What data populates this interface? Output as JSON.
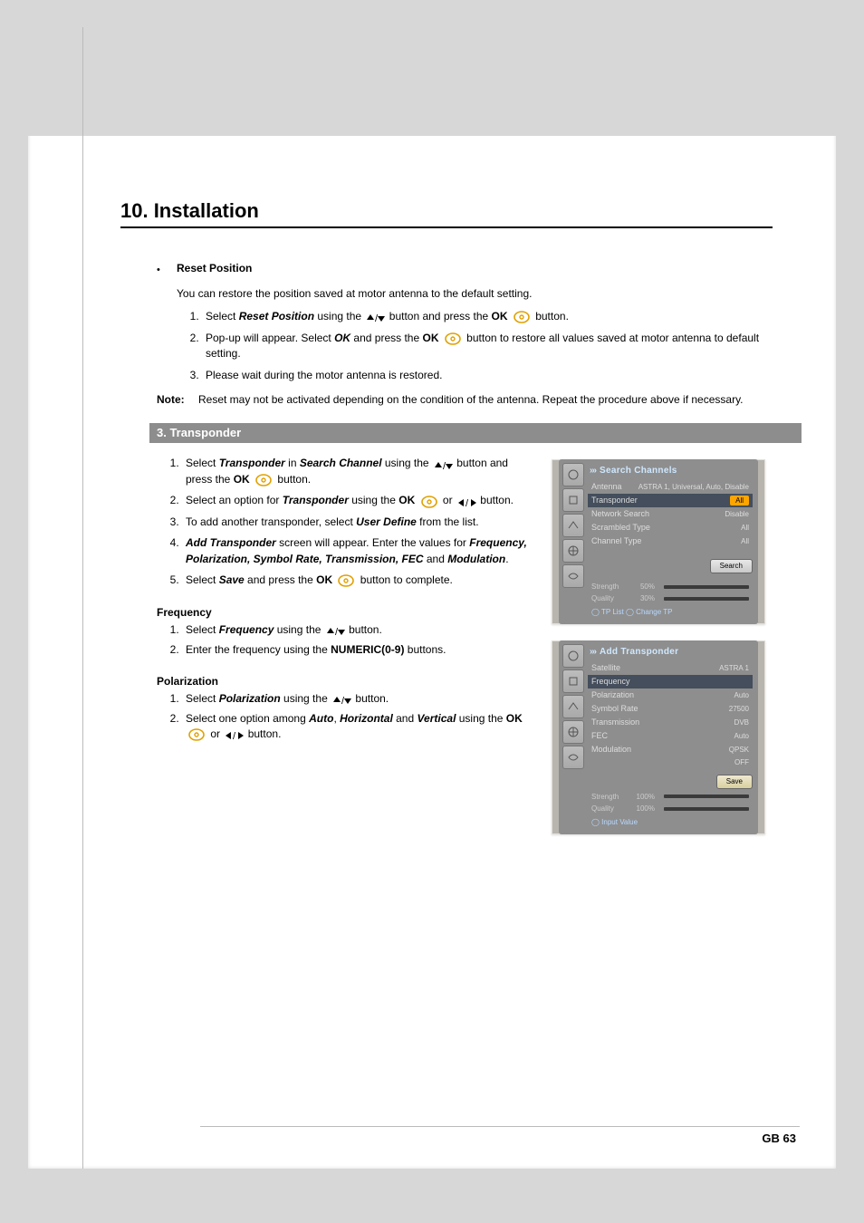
{
  "section_title": "10. Installation",
  "reset": {
    "label": "Reset Position",
    "intro": "You can restore the position saved at motor antenna to the default setting.",
    "s1_a": "Select ",
    "s1_b": "Reset Position",
    "s1_c": " using the ",
    "s1_d": " button and press the ",
    "s1_e": "OK",
    "s1_f": " button.",
    "s2_a": "Pop-up will appear. Select ",
    "s2_b": "OK",
    "s2_c": " and press the ",
    "s2_d": "OK",
    "s2_e": " button to restore all values saved at motor antenna to default setting.",
    "s3": "Please wait during the motor antenna is restored."
  },
  "note": {
    "label": "Note:",
    "text": "Reset may not be activated depending on the condition of the antenna. Repeat the procedure above if necessary."
  },
  "sub_title": "3. Transponder",
  "trans": {
    "s1_a": "Select ",
    "s1_b": "Transponder",
    "s1_c": " in ",
    "s1_d": "Search Channel",
    "s1_e": " using the ",
    "s1_f": " button and press the ",
    "s1_g": "OK",
    "s1_h": " button.",
    "s2_a": "Select an option for ",
    "s2_b": "Transponder",
    "s2_c": " using the ",
    "s2_d": "OK",
    "s2_e": " or ",
    "s2_f": " button.",
    "s3_a": "To add another transponder, select ",
    "s3_b": "User Define",
    "s3_c": " from the list.",
    "s4_a": "Add Transponder",
    "s4_b": " screen will appear. Enter the values for ",
    "s4_c": "Frequency, Polarization, Symbol Rate, Transmission, FEC",
    "s4_d": " and ",
    "s4_e": "Modulation",
    "s4_f": ".",
    "s5_a": "Select ",
    "s5_b": "Save",
    "s5_c": " and press the ",
    "s5_d": "OK",
    "s5_e": " button to complete."
  },
  "freq": {
    "title": "Frequency",
    "s1_a": "Select ",
    "s1_b": "Frequency",
    "s1_c": " using the ",
    "s1_d": " button.",
    "s2_a": "Enter the frequency using the ",
    "s2_b": "NUMERIC(0-9)",
    "s2_c": " buttons."
  },
  "pol": {
    "title": "Polarization",
    "s1_a": "Select ",
    "s1_b": "Polarization",
    "s1_c": " using the ",
    "s1_d": " button.",
    "s2_a": "Select one option among ",
    "s2_b": "Auto",
    "s2_c": ", ",
    "s2_d": "Horizontal",
    "s2_e": " and ",
    "s2_f": "Vertical",
    "s2_g": " using the ",
    "s2_h": "OK",
    "s2_i": " or ",
    "s2_j": " button."
  },
  "osd1": {
    "title": "Search Channels",
    "rows": [
      {
        "label": "Antenna",
        "value": "ASTRA 1, Universal, Auto, Disable"
      },
      {
        "label": "Transponder",
        "value": "All"
      },
      {
        "label": "Network Search",
        "value": "Disable"
      },
      {
        "label": "Scrambled Type",
        "value": "All"
      },
      {
        "label": "Channel Type",
        "value": "All"
      }
    ],
    "button": "Search",
    "meters": [
      {
        "label": "Strength",
        "pct": "50%",
        "fill": 50
      },
      {
        "label": "Quality",
        "pct": "30%",
        "fill": 30
      }
    ],
    "hint": "◯ TP List  ◯ Change TP"
  },
  "osd2": {
    "title": "Add Transponder",
    "rows": [
      {
        "label": "Satellite",
        "value": "ASTRA 1"
      },
      {
        "label": "Frequency",
        "value": ""
      },
      {
        "label": "Polarization",
        "value": "Auto"
      },
      {
        "label": "Symbol Rate",
        "value": "27500"
      },
      {
        "label": "Transmission",
        "value": "DVB"
      },
      {
        "label": "FEC",
        "value": "Auto"
      },
      {
        "label": "Modulation",
        "value": "QPSK"
      },
      {
        "label": "",
        "value": "OFF"
      }
    ],
    "button": "Save",
    "meters": [
      {
        "label": "Strength",
        "pct": "100%",
        "fill": 100
      },
      {
        "label": "Quality",
        "pct": "100%",
        "fill": 100
      }
    ],
    "hint": "◯ Input Value"
  },
  "page_number": "GB 63"
}
